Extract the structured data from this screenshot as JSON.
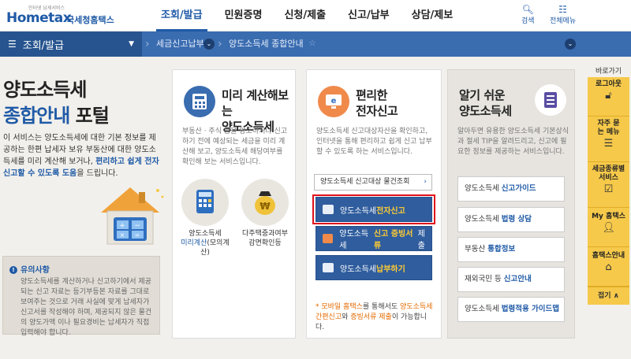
{
  "header": {
    "logo_text": "Hometax",
    "logo_tagline": "인터넷 납세서비스",
    "agency": "국세청홈택스",
    "nav": [
      "조회/발급",
      "민원증명",
      "신청/제출",
      "신고/납부",
      "상담/제보"
    ],
    "search_label": "검색",
    "allmenu_label": "전체메뉴"
  },
  "breadcrumb": {
    "menu_label": "조회/발급",
    "items": [
      "세금신고납부",
      "양도소득세 종합안내"
    ]
  },
  "intro": {
    "title_line1": "양도소득세",
    "title_line2_blue": "종합안내",
    "title_line2_rest": " 포털",
    "desc_text": "이 서비스는 양도소득세에 대한 기본 정보를 제공하는 한편 납세자 보유 부동산에 대한 양도소득세를 미리 계산해 보거나, ",
    "desc_highlight": "편리하고 쉽게 전자신고할 수 있도록 도움",
    "desc_tail": "을 드립니다."
  },
  "notice": {
    "title": "유의사항",
    "body": "양도소득세를 계산하거나 신고하기에서 제공되는 신고 자료는 등기부등본 자료를 그대로 보여주는 것으로 거래 사실에 맞게 납세자가 신고서를 작성해야 하며, 제공되지 않은 물건의 양도가액 이나 필요경비는 납세자가 직접 입력해야 합니다."
  },
  "cards": {
    "calc": {
      "title_line1": "미리 계산해보는",
      "title_line2": "양도소득세",
      "desc": "부동산 · 주식 등을 양도하거나 신고하기 전에 예상되는 세금을 미리 계산해 보고, 양도소득세 해당여부를 확인해 보는 서비스입니다.",
      "feature1_line1": "양도소득세",
      "feature1_blue": "미리계산",
      "feature1_rest": "(모의계산)",
      "feature2_line1": "다주택중과여부",
      "feature2_line2": "감면확인등"
    },
    "efile": {
      "title_line1": "편리한",
      "title_line2": "전자신고",
      "desc": "양도소득세 신고대상자산을 확인하고, 인터넷을 통해 편리하고 쉽게 신고 납부할 수 있도록 하는 서비스입니다.",
      "search_label": "양도소득세 신고대상 물건조회",
      "btn1_pre": "양도소득세 ",
      "btn1_em": "전자신고",
      "btn2_pre": "양도소득세 ",
      "btn2_em": "신고 증빙서류",
      "btn2_post": " 제출",
      "btn3_pre": "양도소득세 ",
      "btn3_em": "납부하기",
      "mobile_a": "* 모바일 홈택스",
      "mobile_b": "를 통해서도 ",
      "mobile_c": "양도소득세 간편신고",
      "mobile_d": "와 ",
      "mobile_e": "증빙서류 제출",
      "mobile_f": "이 가능합니다."
    },
    "guide": {
      "title_line1": "알기 쉬운",
      "title_line2": "양도소득세",
      "desc": "알아두면 유용한 양도소득세 기본상식과 절세 TIP을 알려드리고, 신고에 필요한 정보를 제공하는 서비스입니다.",
      "link1_pre": "양도소득세 ",
      "link1_em": "신고가이드",
      "link2_pre": "양도소득세 ",
      "link2_em": "법령 상담",
      "link3_pre": "부동산 ",
      "link3_em": "통합정보",
      "link4_pre": "재외국민 등 ",
      "link4_em": "신고안내",
      "link5_pre": "양도소득세 ",
      "link5_em": "법령적용 가이드맵"
    }
  },
  "quick": {
    "head": "바로가기",
    "items": [
      "로그아웃",
      "자주 묻는 메뉴",
      "세금종류별 서비스",
      "My 홈택스",
      "홈택스안내"
    ],
    "fold": "접기 ∧"
  },
  "colors": {
    "brand_blue": "#1f5aa6",
    "highlight_red": "#e0101b",
    "quick_yellow": "#f6c94a"
  }
}
